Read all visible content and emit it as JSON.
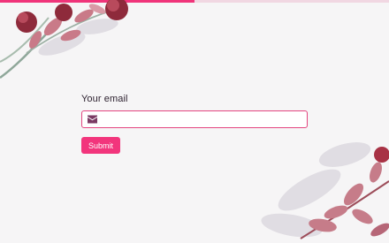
{
  "progress": {
    "fraction": 0.5,
    "color": "#f0347a"
  },
  "form": {
    "email_label": "Your email",
    "email_value": "",
    "email_icon": "envelope-icon",
    "submit_label": "Submit"
  },
  "colors": {
    "accent": "#f2357c",
    "field_border": "#e3457f",
    "icon": "#7a3a63"
  }
}
